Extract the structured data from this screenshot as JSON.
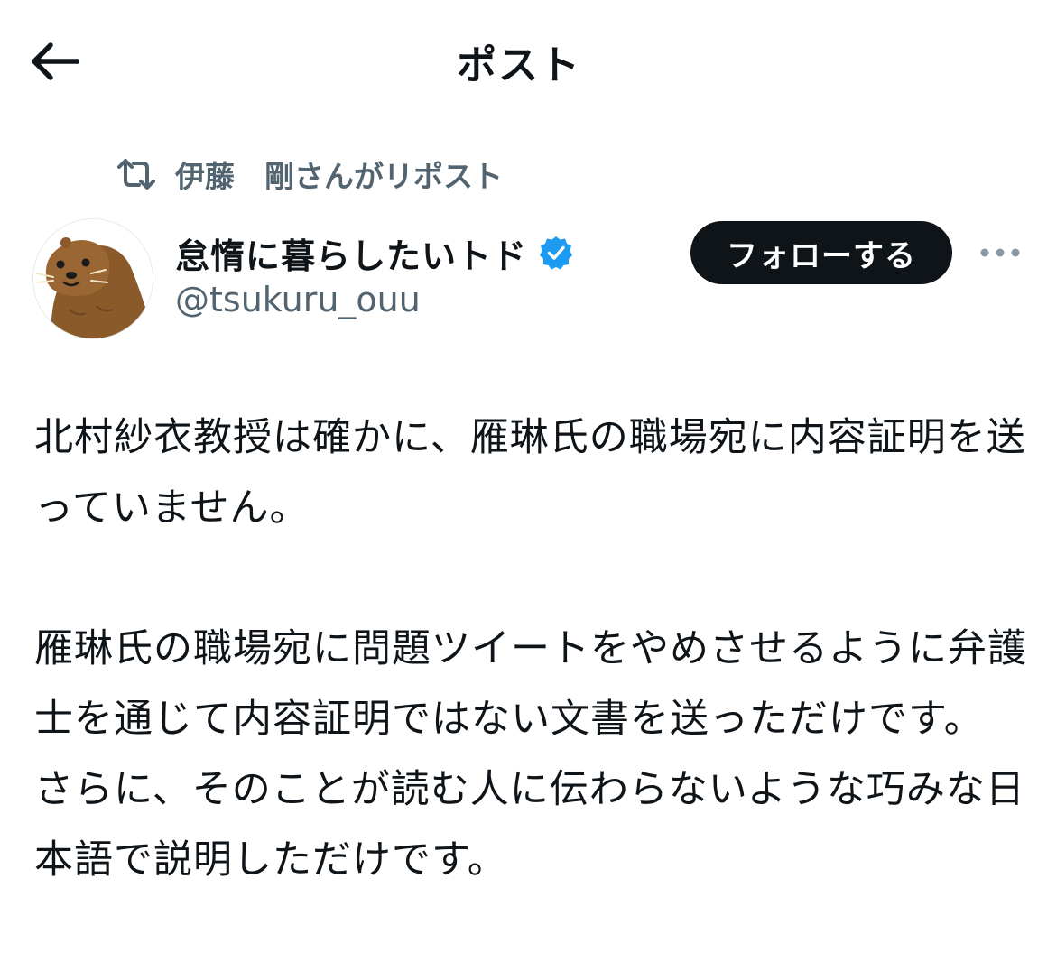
{
  "header": {
    "title": "ポスト",
    "back_icon": "arrow-left-icon"
  },
  "repost": {
    "icon": "repost-icon",
    "text": "伊藤　剛さんがリポスト"
  },
  "author": {
    "name": "怠惰に暮らしたいトド",
    "handle": "@tsukuru_ouu",
    "verified_icon": "verified-badge-icon",
    "verified_color": "#1d9bf0"
  },
  "actions": {
    "follow_label": "フォローする",
    "more_icon": "more-dots-icon"
  },
  "post": {
    "paragraphs": [
      "北村紗衣教授は確かに、雁琳氏の職場宛に内容証明を送っていません。",
      "",
      "雁琳氏の職場宛に問題ツイートをやめさせるように弁護士を通じて内容証明ではない文書を送っただけです。",
      "さらに、そのことが読む人に伝わらないような巧みな日本語で説明しただけです。"
    ]
  },
  "colors": {
    "text_primary": "#0f1419",
    "text_secondary": "#536471",
    "button_bg": "#0f1419",
    "button_text": "#ffffff",
    "accent": "#1d9bf0"
  }
}
